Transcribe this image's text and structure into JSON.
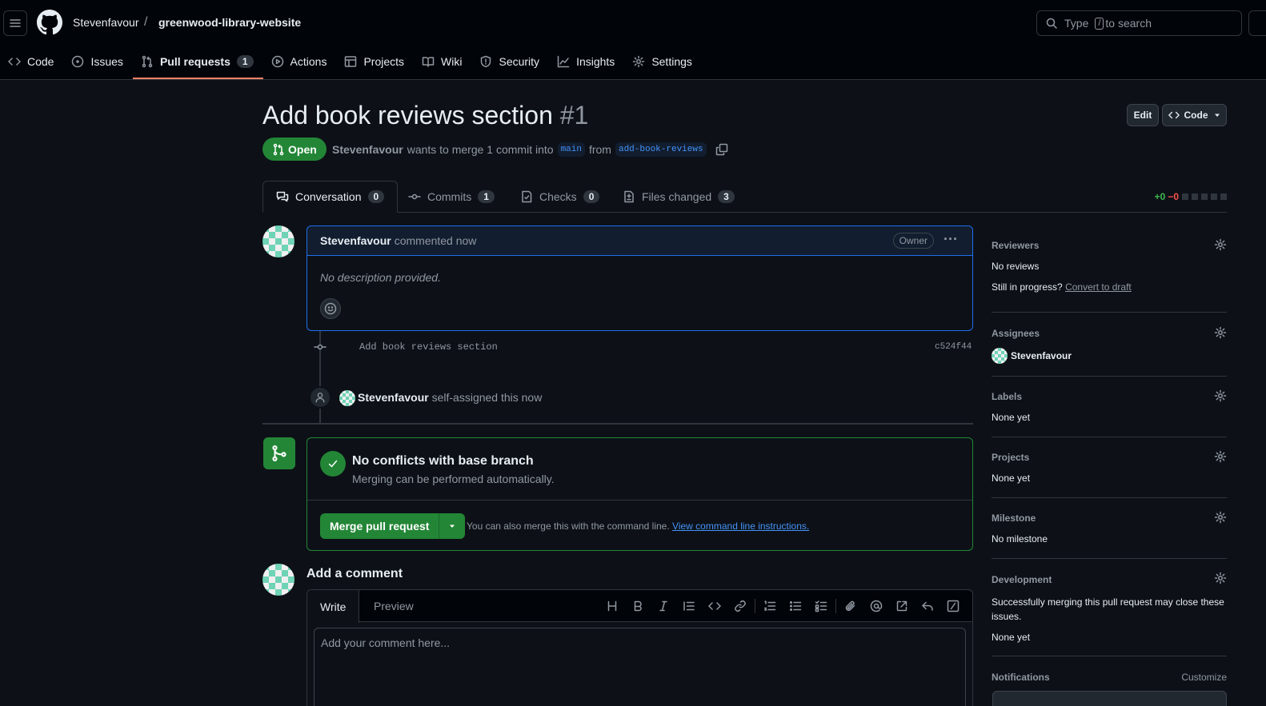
{
  "header": {
    "owner": "Stevenfavour",
    "separator": "/",
    "repo": "greenwood-library-website",
    "search_prefix": "Type",
    "search_key": "/",
    "search_suffix": "to search"
  },
  "nav": {
    "code": "Code",
    "issues": "Issues",
    "pulls": "Pull requests",
    "pulls_count": "1",
    "actions": "Actions",
    "projects": "Projects",
    "wiki": "Wiki",
    "security": "Security",
    "insights": "Insights",
    "settings": "Settings"
  },
  "pr": {
    "title": "Add book reviews section",
    "number": "#1",
    "edit_label": "Edit",
    "code_label": "Code",
    "state": "Open",
    "author": "Stevenfavour",
    "meta_text": "wants to merge 1 commit into",
    "base": "main",
    "from_text": "from",
    "head": "add-book-reviews"
  },
  "tabs": {
    "conversation": "Conversation",
    "conversation_count": "0",
    "commits": "Commits",
    "commits_count": "1",
    "checks": "Checks",
    "checks_count": "0",
    "files": "Files changed",
    "files_count": "3",
    "additions": "+0",
    "deletions": "−0"
  },
  "comment": {
    "author": "Stevenfavour",
    "action": "commented now",
    "role": "Owner",
    "body": "No description provided."
  },
  "timeline": {
    "commit_message": "Add book reviews section",
    "commit_sha": "c524f44",
    "event_user": "Stevenfavour",
    "event_text": "self-assigned this now"
  },
  "merge": {
    "title": "No conflicts with base branch",
    "subtitle": "Merging can be performed automatically.",
    "button": "Merge pull request",
    "hint": "You can also merge this with the command line.",
    "hint_link": "View command line instructions."
  },
  "add_comment": {
    "title": "Add a comment",
    "write_tab": "Write",
    "preview_tab": "Preview",
    "placeholder": "Add your comment here..."
  },
  "sidebar": {
    "reviewers_h": "Reviewers",
    "reviewers_v": "No reviews",
    "draft_q": "Still in progress?",
    "draft_link": "Convert to draft",
    "assignees_h": "Assignees",
    "assignee": "Stevenfavour",
    "labels_h": "Labels",
    "labels_v": "None yet",
    "projects_h": "Projects",
    "projects_v": "None yet",
    "milestone_h": "Milestone",
    "milestone_v": "No milestone",
    "development_h": "Development",
    "development_desc": "Successfully merging this pull request may close these issues.",
    "development_v": "None yet",
    "notifications_h": "Notifications",
    "customize": "Customize"
  },
  "colors": {
    "background": "#0d1117",
    "accent_green": "#238636",
    "link_blue": "#4493f8",
    "nav_underline": "#f78166"
  }
}
